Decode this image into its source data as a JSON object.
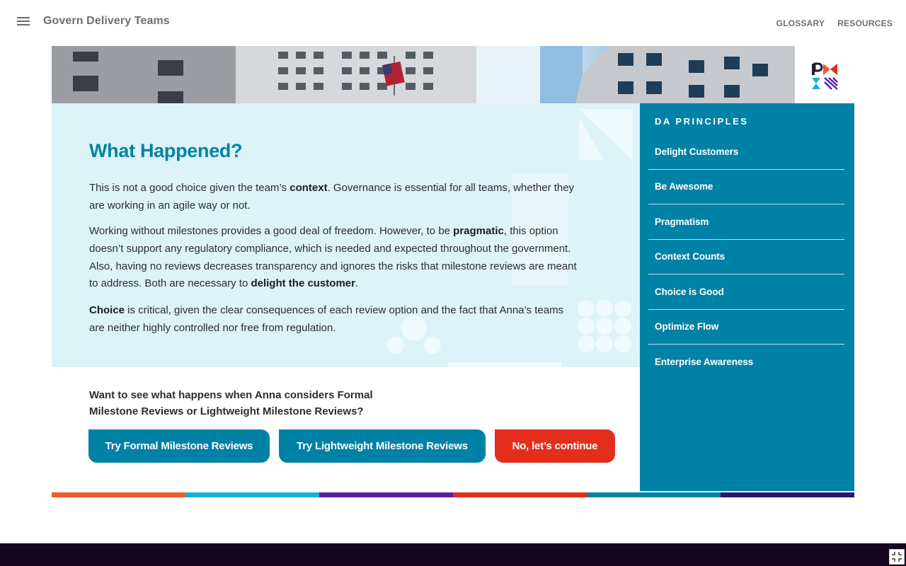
{
  "app": {
    "title": "Govern Delivery Teams"
  },
  "nav": {
    "glossary": "GLOSSARY",
    "resources": "RESOURCES"
  },
  "content": {
    "heading": "What Happened?",
    "p1": {
      "a": "This is not a good choice given the team’s ",
      "b": "context",
      "c": ". Governance is essential for all teams, whether they are working in an agile way or not."
    },
    "p2": {
      "a": "Working without milestones provides a good deal of freedom. However, to be ",
      "b": "pragmatic",
      "c": ", this option doesn’t support any regulatory compliance, which is needed and expected throughout the government. Also, having no reviews decreases transparency and ignores the risks that milestone reviews are meant to address. Both are necessary to ",
      "d": "delight the customer",
      "e": "."
    },
    "p3": {
      "a": "Choice",
      "b": " is critical, given the clear consequences of each review option and the fact that Anna’s teams are neither highly controlled nor free from regulation."
    }
  },
  "prompt": "Want to see what happens when Anna considers Formal Milestone Reviews or Lightweight Milestone Reviews?",
  "buttons": {
    "formal": "Try Formal Milestone Reviews",
    "lightweight": "Try Lightweight Milestone Reviews",
    "continue": "No, let’s continue"
  },
  "sidebar": {
    "title": "DA PRINCIPLES",
    "items": [
      {
        "label": "Delight Customers"
      },
      {
        "label": "Be Awesome"
      },
      {
        "label": "Pragmatism"
      },
      {
        "label": "Context Counts"
      },
      {
        "label": "Choice is Good"
      },
      {
        "label": "Optimize Flow"
      },
      {
        "label": "Enterprise Awareness"
      }
    ]
  },
  "colors": {
    "accent_teal": "#0081a6",
    "heading_teal": "#0083a4",
    "panel_bg": "#dcf3f8",
    "continue_red": "#e42e1c",
    "footer_dark": "#150620",
    "strip": [
      "#f15a29",
      "#17b1d8",
      "#5a1fa0",
      "#e42e1c",
      "#0081a6",
      "#2c1572"
    ]
  },
  "icons": {
    "menu": "hamburger-menu-icon",
    "logo": "pmi-logo",
    "fullscreen": "exit-fullscreen-icon"
  }
}
